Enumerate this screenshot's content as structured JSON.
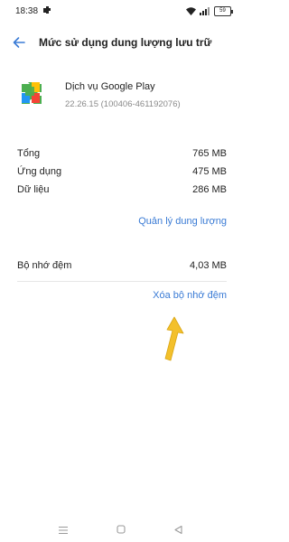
{
  "status_bar": {
    "time": "18:38",
    "battery": "59",
    "icons": [
      "app-notification-icon",
      "wifi-icon",
      "signal-icon",
      "battery-icon"
    ]
  },
  "header": {
    "title": "Mức sử dụng dung lượng lưu trữ",
    "back_icon": "back-arrow-icon"
  },
  "app": {
    "name": "Dịch vụ Google Play",
    "version": "22.26.15 (100406-461192076)",
    "icon": "google-play-services-icon"
  },
  "storage": {
    "rows": [
      {
        "label": "Tổng",
        "value": "765 MB"
      },
      {
        "label": "Ứng dụng",
        "value": "475 MB"
      },
      {
        "label": "Dữ liệu",
        "value": "286 MB"
      }
    ],
    "manage_link": "Quản lý dung lượng"
  },
  "cache": {
    "label": "Bộ nhớ đệm",
    "value": "4,03 MB",
    "clear_link": "Xóa bộ nhớ đệm"
  },
  "annotation": {
    "icon": "yellow-arrow-annotation",
    "color": "#f3c02b"
  },
  "nav_bar": {
    "icons": [
      "menu-icon",
      "home-icon",
      "back-icon"
    ]
  },
  "colors": {
    "accent": "#3a7bd5",
    "secondary_text": "#8a8a8a"
  }
}
